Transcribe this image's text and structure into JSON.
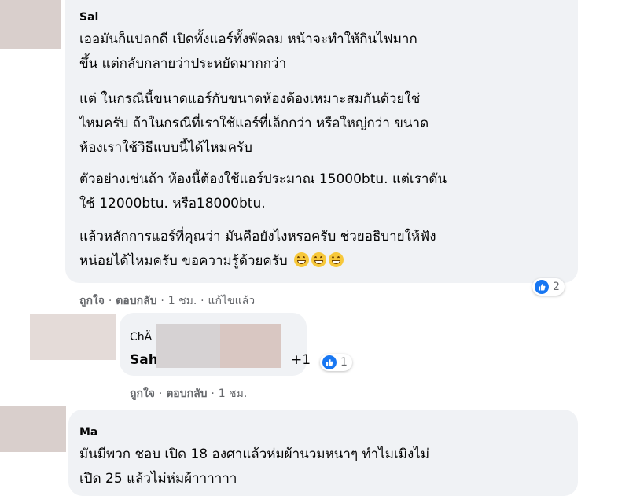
{
  "comment1": {
    "author": "Sal",
    "paragraphs": [
      [
        "เออมันก็แปลกดี เปิดทั้งแอร์ทั้งพัดลม หน้าจะทำให้กินไฟมาก",
        "ขึ้น แต่กลับกลายว่าประหยัดมากกว่า"
      ],
      [
        "แต่ ในกรณีนี้ขนาดแอร์กับขนาดห้องต้องเหมาะสมกันด้วยใช่",
        "ไหมครับ ถ้าในกรณีที่เราใช้แอร์ที่เล็กกว่า หรือใหญ่กว่า ขนาด",
        "ห้องเราใช้วิธีแบบนี้ได้ไหมครับ"
      ],
      [
        "ตัวอย่างเช่นถ้า ห้องนี้ต้องใช้แอร์ประมาณ 15000btu. แต่เราดัน",
        "ใช้ 12000btu. หรือ18000btu."
      ],
      [
        "แล้วหลักการแอร์ที่คุณว่า มันคือยังไงหรอครับ ช่วยอธิบายให้ฟัง",
        "หน่อยได้ไหมครับ ขอความรู้ด้วยครับ"
      ]
    ],
    "emoji": [
      "grinning-face-emoji",
      "grinning-face-emoji",
      "grinning-face-emoji"
    ],
    "reaction_count": "2",
    "actions": {
      "like": "ถูกใจ",
      "reply": "ตอบกลับ",
      "time": "1 ชม.",
      "edited": "แก้ไขแล้ว"
    }
  },
  "reply1": {
    "author": "ChÄ",
    "text": "Sah",
    "extra": "+1",
    "reaction_count": "1",
    "actions": {
      "like": "ถูกใจ",
      "reply": "ตอบกลับ",
      "time": "1 ชม."
    }
  },
  "comment2": {
    "author": "Ma",
    "lines": [
      "มันมีพวก ชอบ เปิด 18 องศาแล้วห่มผ้านวมหนาๆ ทำไมเมิงไม่",
      "เปิด 25 แล้วไม่ห่มผ้าาาาาา"
    ]
  },
  "separator": "·",
  "colors": {
    "bubble": "#f0f2f5",
    "like_blue": "#1877f2",
    "meta_gray": "#65676b"
  }
}
